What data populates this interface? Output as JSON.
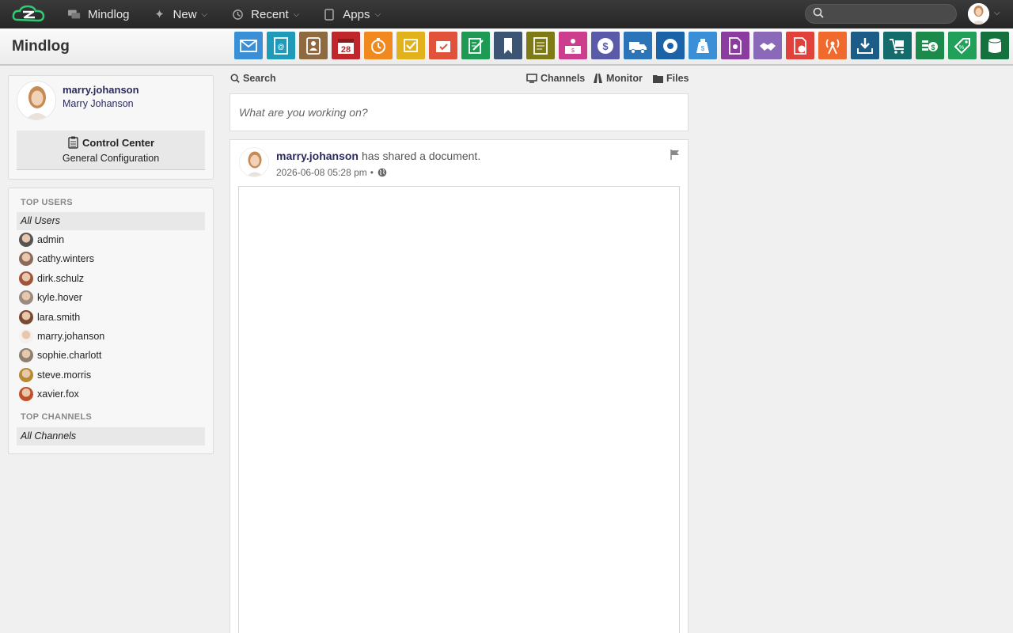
{
  "topbar": {
    "nav": [
      {
        "label": "Mindlog",
        "icon": "chat-icon",
        "has_dropdown": false
      },
      {
        "label": "New",
        "icon": "sparkle-icon",
        "has_dropdown": true
      },
      {
        "label": "Recent",
        "icon": "history-icon",
        "has_dropdown": true
      },
      {
        "label": "Apps",
        "icon": "tablet-icon",
        "has_dropdown": true
      }
    ],
    "search_placeholder": ""
  },
  "appbar": {
    "title": "Mindlog",
    "apps": [
      {
        "name": "mail-app",
        "color": "#3b8fd6"
      },
      {
        "name": "address-app",
        "color": "#1f9bb9"
      },
      {
        "name": "contacts-app",
        "color": "#8d6a3f"
      },
      {
        "name": "calendar-app",
        "color": "#c0272d",
        "label": "28"
      },
      {
        "name": "timer-app",
        "color": "#f2891f"
      },
      {
        "name": "tasks-app",
        "color": "#e1b21b"
      },
      {
        "name": "projects-app",
        "color": "#e0523a"
      },
      {
        "name": "notes-app",
        "color": "#1e9a55"
      },
      {
        "name": "bookmarks-app",
        "color": "#3c5572"
      },
      {
        "name": "documents-app",
        "color": "#7e7a16"
      },
      {
        "name": "cashier-app",
        "color": "#cc3d8e"
      },
      {
        "name": "finance-app",
        "color": "#5a5aa8"
      },
      {
        "name": "shipping-app",
        "color": "#2b74b8"
      },
      {
        "name": "support-app",
        "color": "#1c62a7"
      },
      {
        "name": "budget-app",
        "color": "#3b8fd6"
      },
      {
        "name": "contracts-app",
        "color": "#8b3d9f"
      },
      {
        "name": "partners-app",
        "color": "#8a6ab8"
      },
      {
        "name": "forms-app",
        "color": "#e0413b"
      },
      {
        "name": "broadcast-app",
        "color": "#ef6a2c"
      },
      {
        "name": "downloads-app",
        "color": "#1b5d87"
      },
      {
        "name": "shop-app",
        "color": "#136b6b"
      },
      {
        "name": "billing-app",
        "color": "#1b8a4a"
      },
      {
        "name": "pricing-app",
        "color": "#21a05a"
      },
      {
        "name": "database-app",
        "color": "#15713e"
      }
    ]
  },
  "profile": {
    "username": "marry.johanson",
    "full_name": "Marry Johanson",
    "control_center_title": "Control Center",
    "control_center_sub": "General Configuration"
  },
  "sidebar": {
    "top_users_heading": "TOP USERS",
    "all_users_label": "All Users",
    "users": [
      {
        "name": "admin",
        "color": "#555"
      },
      {
        "name": "cathy.winters",
        "color": "#8a6b5a"
      },
      {
        "name": "dirk.schulz",
        "color": "#a0553a"
      },
      {
        "name": "kyle.hover",
        "color": "#9a8b80"
      },
      {
        "name": "lara.smith",
        "color": "#7a4a30"
      },
      {
        "name": "marry.johanson",
        "color": "#f5f0ec"
      },
      {
        "name": "sophie.charlott",
        "color": "#8c8070"
      },
      {
        "name": "steve.morris",
        "color": "#b58a30"
      },
      {
        "name": "xavier.fox",
        "color": "#c0502a"
      }
    ],
    "top_channels_heading": "TOP CHANNELS",
    "all_channels_label": "All Channels"
  },
  "feed": {
    "tabs": {
      "search": "Search",
      "channels": "Channels",
      "monitor": "Monitor",
      "files": "Files"
    },
    "compose_placeholder": "What are you working on?",
    "post": {
      "author": "marry.johanson",
      "action": "has shared a document.",
      "timestamp": "2026-06-08 05:28 pm",
      "separator": "•"
    }
  }
}
